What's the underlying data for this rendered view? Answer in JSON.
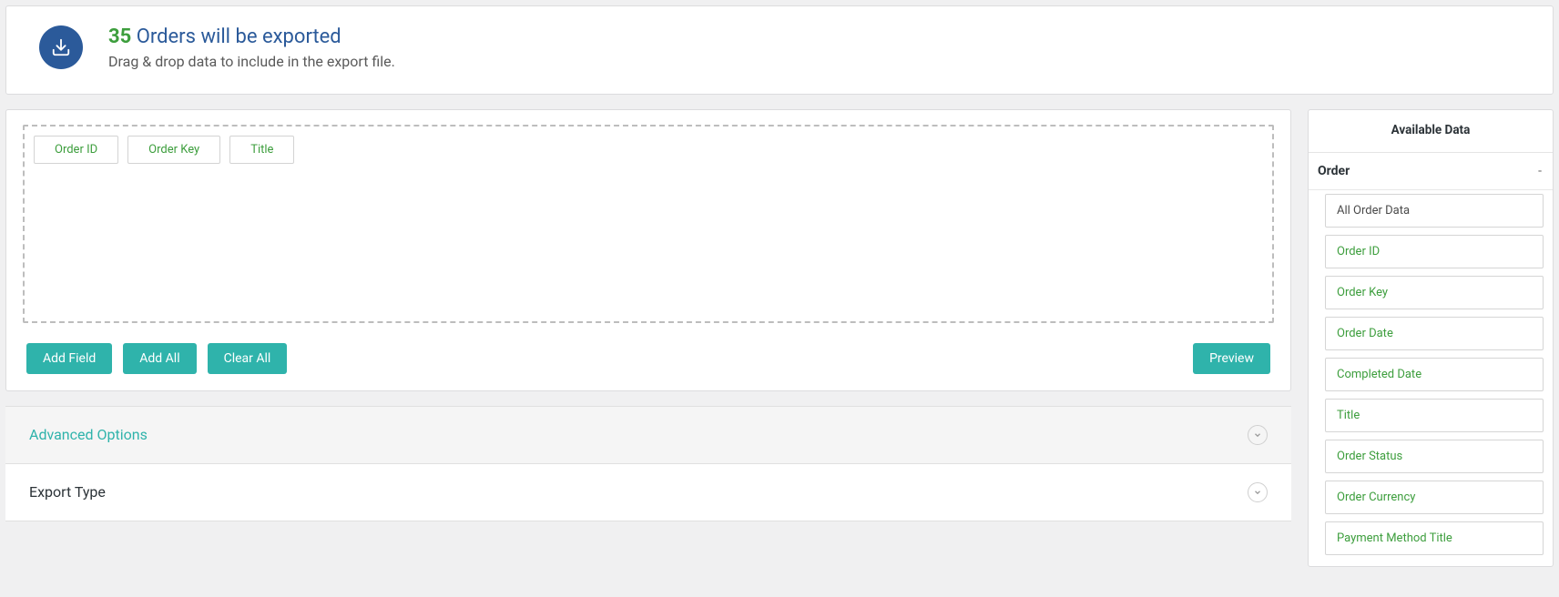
{
  "header": {
    "count": "35",
    "title_rest": "Orders will be exported",
    "sub": "Drag & drop data to include in the export file."
  },
  "selected_fields": [
    "Order ID",
    "Order Key",
    "Title"
  ],
  "buttons": {
    "add_field": "Add Field",
    "add_all": "Add All",
    "clear_all": "Clear All",
    "preview": "Preview"
  },
  "accordions": {
    "advanced": "Advanced Options",
    "export_type": "Export Type"
  },
  "sidebar": {
    "title": "Available Data",
    "group": "Order",
    "items": [
      {
        "label": "All Order Data",
        "neutral": true
      },
      {
        "label": "Order ID",
        "neutral": false
      },
      {
        "label": "Order Key",
        "neutral": false
      },
      {
        "label": "Order Date",
        "neutral": false
      },
      {
        "label": "Completed Date",
        "neutral": false
      },
      {
        "label": "Title",
        "neutral": false
      },
      {
        "label": "Order Status",
        "neutral": false
      },
      {
        "label": "Order Currency",
        "neutral": false
      },
      {
        "label": "Payment Method Title",
        "neutral": false
      }
    ]
  }
}
